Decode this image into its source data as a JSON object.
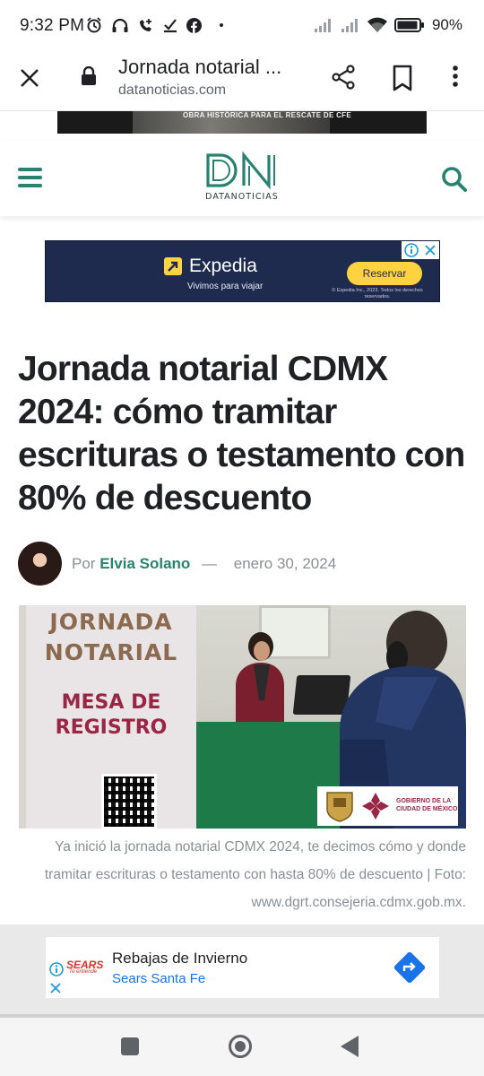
{
  "status_bar": {
    "time": "9:32 PM",
    "battery": "90%",
    "icons": [
      "alarm-icon",
      "headphones-icon",
      "call-icon",
      "download-done-icon",
      "facebook-icon",
      "dot-icon",
      "signal-icon",
      "signal-icon",
      "wifi-icon",
      "battery-icon"
    ]
  },
  "browser": {
    "page_title": "Jornada notarial ...",
    "domain": "datanoticias.com",
    "icons": [
      "close-icon",
      "lock-icon",
      "share-icon",
      "bookmark-icon",
      "more-vert-icon"
    ]
  },
  "top_banner": {
    "text": "OBRA HISTÓRICA PARA EL RESCATE DE CFE"
  },
  "site_header": {
    "logo_text": "DATANOTICIAS",
    "brand_color": "#27836f",
    "icons": [
      "hamburger-icon",
      "search-icon"
    ]
  },
  "ad_expedia": {
    "brand": "Expedia",
    "tagline": "Vivimos para viajar",
    "cta": "Reservar",
    "legal": "© Expedia Inc., 2023. Todos los derechos reservados.",
    "bg_color": "#1f2a4f",
    "accent_color": "#ffd23f"
  },
  "article": {
    "headline": "Jornada notarial CDMX 2024: cómo tramitar escrituras o testamento con 80% de descuento",
    "byline_prefix": "Por",
    "author": "Elvia Solano",
    "separator": "—",
    "date": "enero 30, 2024",
    "hero": {
      "banner_line1": "JORNADA",
      "banner_line2": "NOTARIAL",
      "banner_line3": "MESA DE",
      "banner_line4": "REGISTRO",
      "gov_line1": "GOBIERNO DE LA",
      "gov_line2": "CIUDAD DE MÉXICO"
    },
    "caption": "Ya inició la jornada notarial CDMX 2024, te decimos cómo y donde tramitar escrituras o testamento con hasta 80% de descuento | Foto: www.dgrt.consejeria.cdmx.gob.mx."
  },
  "bottom_ad": {
    "logo": "SEARS",
    "logo_sub": "Te entiende",
    "title": "Rebajas de Invierno",
    "subtitle": "Sears Santa Fe",
    "icons": [
      "ad-info-icon",
      "close-icon",
      "directions-icon"
    ]
  },
  "nav_bar": {
    "icons": [
      "recents-icon",
      "home-icon",
      "back-icon"
    ]
  }
}
